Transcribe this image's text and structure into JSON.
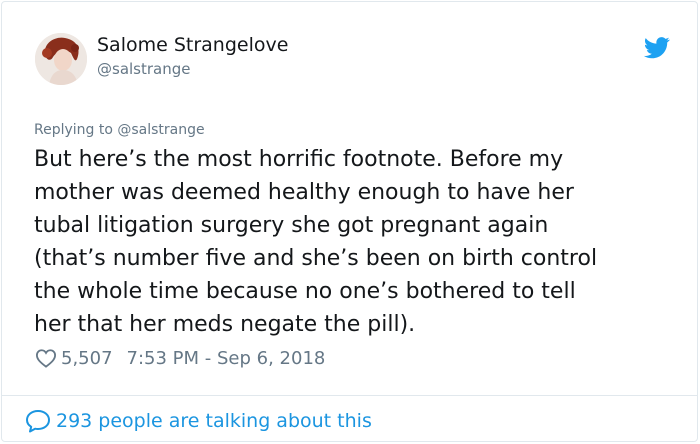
{
  "author": {
    "name": "Salome Strangelove",
    "handle": "@salstrange"
  },
  "replying_to": "Replying to @salstrange",
  "tweet_lines": [
    "But here’s the most horrific footnote. Before my",
    "mother was deemed healthy enough to have her",
    "tubal litigation surgery she got pregnant again",
    "(that’s number five and she’s been on birth control",
    "the whole time because no one’s bothered to tell",
    "her that her meds negate the pill)."
  ],
  "meta": {
    "likes": "5,507",
    "timestamp": "7:53 PM - Sep 6, 2018"
  },
  "footer": {
    "talking": "293 people are talking about this"
  },
  "icons": {
    "bird": "twitter-bird-icon",
    "heart": "heart-icon",
    "bubble": "comment-bubble-icon"
  },
  "colors": {
    "twitter_blue": "#1da1f2",
    "link_blue": "#1b95e0",
    "muted_text": "#657786",
    "main_text": "#14171a"
  }
}
